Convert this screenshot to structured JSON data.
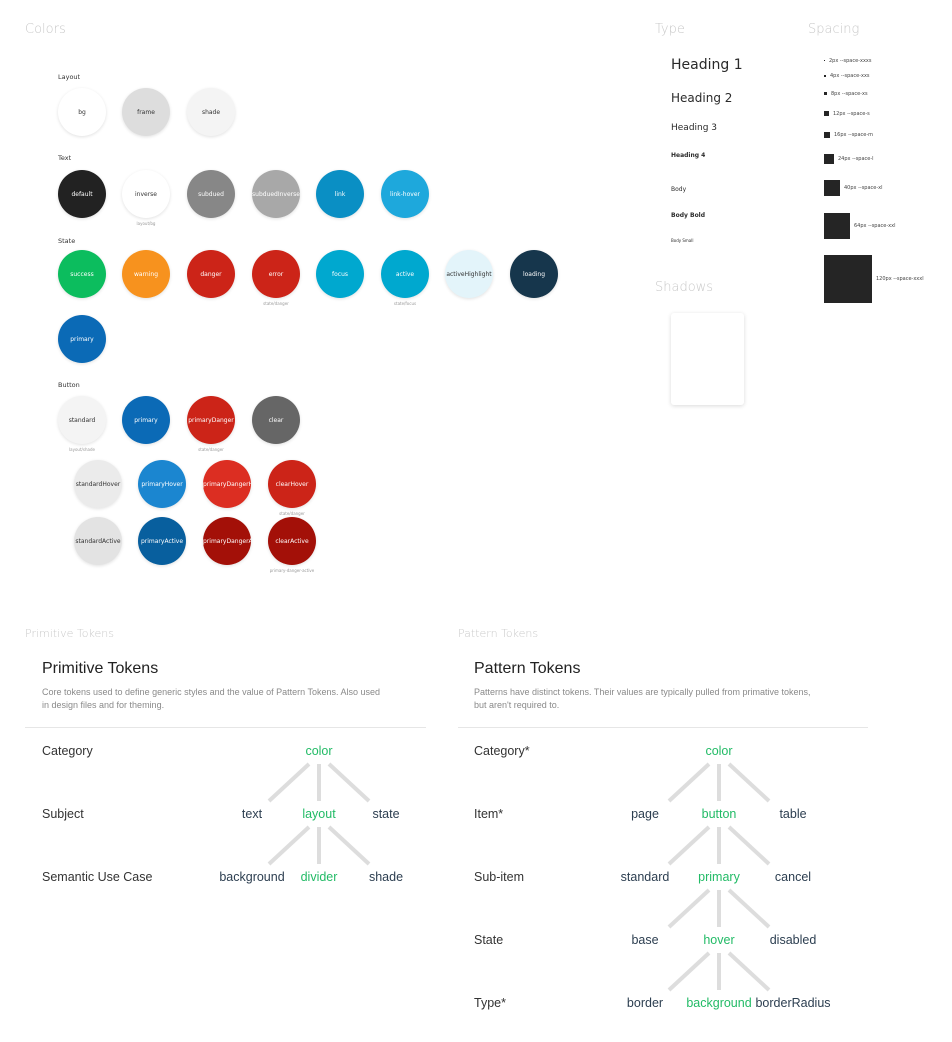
{
  "sections": {
    "colors": "Colors",
    "type": "Type",
    "spacing": "Spacing",
    "shadows": "Shadows",
    "primitive_tokens": "Primitive Tokens",
    "pattern_tokens": "Pattern Tokens"
  },
  "colors": {
    "groups": [
      {
        "label": "Layout",
        "swatches": [
          {
            "name": "bg",
            "color": "#ffffff",
            "text": "#333333",
            "note": ""
          },
          {
            "name": "frame",
            "color": "#dddddd",
            "text": "#333333",
            "note": ""
          },
          {
            "name": "shade",
            "color": "#f4f4f4",
            "text": "#333333",
            "note": ""
          }
        ]
      },
      {
        "label": "Text",
        "swatches": [
          {
            "name": "default",
            "color": "#222222",
            "text": "#ffffff",
            "note": ""
          },
          {
            "name": "inverse",
            "color": "#ffffff",
            "text": "#333333",
            "note": "layout/bg"
          },
          {
            "name": "subdued",
            "color": "#878787",
            "text": "#ffffff",
            "note": ""
          },
          {
            "name": "subduedInverse",
            "color": "#a8a8a8",
            "text": "#ffffff",
            "note": ""
          },
          {
            "name": "link",
            "color": "#0a8fc4",
            "text": "#ffffff",
            "note": ""
          },
          {
            "name": "link-hover",
            "color": "#1ea8dc",
            "text": "#ffffff",
            "note": ""
          }
        ]
      },
      {
        "label": "State",
        "swatches": [
          {
            "name": "success",
            "color": "#0cbd5e",
            "text": "#ffffff",
            "note": ""
          },
          {
            "name": "warning",
            "color": "#f7921e",
            "text": "#ffffff",
            "note": ""
          },
          {
            "name": "danger",
            "color": "#cc2418",
            "text": "#ffffff",
            "note": ""
          },
          {
            "name": "error",
            "color": "#cc2418",
            "text": "#ffffff",
            "note": "state/danger"
          },
          {
            "name": "focus",
            "color": "#00a8cf",
            "text": "#ffffff",
            "note": ""
          },
          {
            "name": "active",
            "color": "#00a8cf",
            "text": "#ffffff",
            "note": "state/focus"
          },
          {
            "name": "activeHighlight",
            "color": "#e3f4fa",
            "text": "#333333",
            "note": ""
          },
          {
            "name": "loading",
            "color": "#16364c",
            "text": "#ffffff",
            "note": ""
          },
          {
            "name": "primary",
            "color": "#0b6ab6",
            "text": "#ffffff",
            "note": ""
          }
        ]
      },
      {
        "label": "Button",
        "swatches": [
          {
            "name": "standard",
            "color": "#f4f4f4",
            "text": "#333333",
            "note": "layout/shade"
          },
          {
            "name": "primary",
            "color": "#0b6ab6",
            "text": "#ffffff",
            "note": ""
          },
          {
            "name": "primaryDanger",
            "color": "#cc2418",
            "text": "#ffffff",
            "note": "state/danger"
          },
          {
            "name": "clear",
            "color": "#666666",
            "text": "#ffffff",
            "note": ""
          },
          {
            "name": "standardHover",
            "color": "#ebebeb",
            "text": "#333333",
            "note": ""
          },
          {
            "name": "primaryHover",
            "color": "#1b86d0",
            "text": "#ffffff",
            "note": ""
          },
          {
            "name": "primaryDangerHover",
            "color": "#dc2e22",
            "text": "#ffffff",
            "note": ""
          },
          {
            "name": "clearHover",
            "color": "#cc2418",
            "text": "#ffffff",
            "note": "state/danger"
          },
          {
            "name": "standardActive",
            "color": "#e3e3e3",
            "text": "#333333",
            "note": ""
          },
          {
            "name": "primaryActive",
            "color": "#085f9e",
            "text": "#ffffff",
            "note": ""
          },
          {
            "name": "primaryDangerActive",
            "color": "#a31008",
            "text": "#ffffff",
            "note": ""
          },
          {
            "name": "clearActive",
            "color": "#a31008",
            "text": "#ffffff",
            "note": "primary-danger-active"
          }
        ]
      }
    ]
  },
  "type": {
    "samples": [
      "Heading 1",
      "Heading 2",
      "Heading 3",
      "Heading 4",
      "Body",
      "Body Bold",
      "Body Small"
    ]
  },
  "spacing": {
    "items": [
      {
        "px": 2,
        "label": "2px --space-xxxs"
      },
      {
        "px": 4,
        "label": "4px --space-xxs"
      },
      {
        "px": 8,
        "label": "8px --space-xs"
      },
      {
        "px": 12,
        "label": "12px --space-s"
      },
      {
        "px": 16,
        "label": "16px --space-m"
      },
      {
        "px": 24,
        "label": "24px --space-l"
      },
      {
        "px": 40,
        "label": "40px --space-xl"
      },
      {
        "px": 64,
        "label": "64px --space-xxl"
      },
      {
        "px": 120,
        "label": "120px --space-xxxl"
      }
    ]
  },
  "primitive": {
    "heading": "Primitive Tokens",
    "description_line1": "Core tokens used to define generic styles and the value of Pattern Tokens. Also used",
    "description_line2": "in design files and for theming.",
    "rows": [
      {
        "label": "Category",
        "nodes": [
          {
            "text": "color",
            "highlight": true
          }
        ]
      },
      {
        "label": "Subject",
        "nodes": [
          {
            "text": "text",
            "highlight": false
          },
          {
            "text": "layout",
            "highlight": true
          },
          {
            "text": "state",
            "highlight": false
          }
        ]
      },
      {
        "label": "Semantic Use Case",
        "nodes": [
          {
            "text": "background",
            "highlight": false
          },
          {
            "text": "divider",
            "highlight": true
          },
          {
            "text": "shade",
            "highlight": false
          }
        ]
      }
    ]
  },
  "pattern": {
    "heading": "Pattern Tokens",
    "description_line1": "Patterns have distinct tokens. Their values are typically pulled from primative tokens,",
    "description_line2": "but aren't required to.",
    "rows": [
      {
        "label": "Category*",
        "nodes": [
          {
            "text": "color",
            "highlight": true
          }
        ]
      },
      {
        "label": "Item*",
        "nodes": [
          {
            "text": "page",
            "highlight": false
          },
          {
            "text": "button",
            "highlight": true
          },
          {
            "text": "table",
            "highlight": false
          }
        ]
      },
      {
        "label": "Sub-item",
        "nodes": [
          {
            "text": "standard",
            "highlight": false
          },
          {
            "text": "primary",
            "highlight": true
          },
          {
            "text": "cancel",
            "highlight": false
          }
        ]
      },
      {
        "label": "State",
        "nodes": [
          {
            "text": "base",
            "highlight": false
          },
          {
            "text": "hover",
            "highlight": true
          },
          {
            "text": "disabled",
            "highlight": false
          }
        ]
      },
      {
        "label": "Type*",
        "nodes": [
          {
            "text": "border",
            "highlight": false
          },
          {
            "text": "background",
            "highlight": true
          },
          {
            "text": "borderRadius",
            "highlight": false
          }
        ]
      }
    ]
  }
}
